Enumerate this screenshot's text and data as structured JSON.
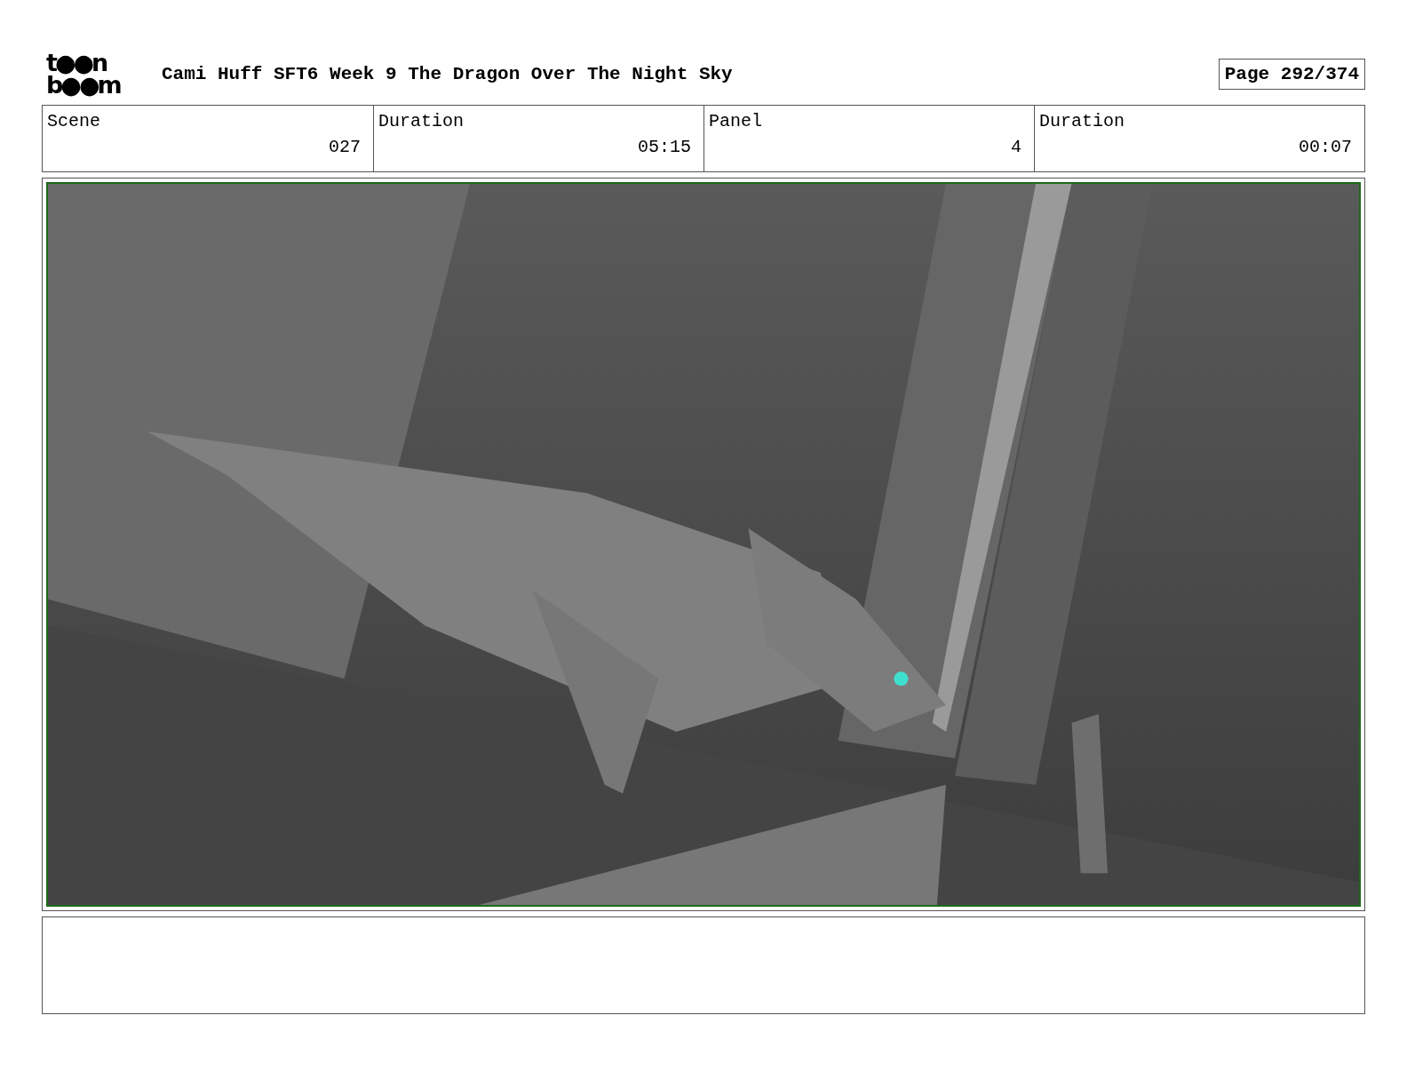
{
  "logo": {
    "lines": [
      "t●●n",
      "b●●m"
    ]
  },
  "title": "Cami Huff SFT6 Week 9 The Dragon Over The Night Sky",
  "page": "Page 292/374",
  "fields": [
    {
      "label": "Scene",
      "value": "027"
    },
    {
      "label": "Duration",
      "value": "05:15"
    },
    {
      "label": "Panel",
      "value": "4"
    },
    {
      "label": "Duration",
      "value": "00:07"
    }
  ]
}
